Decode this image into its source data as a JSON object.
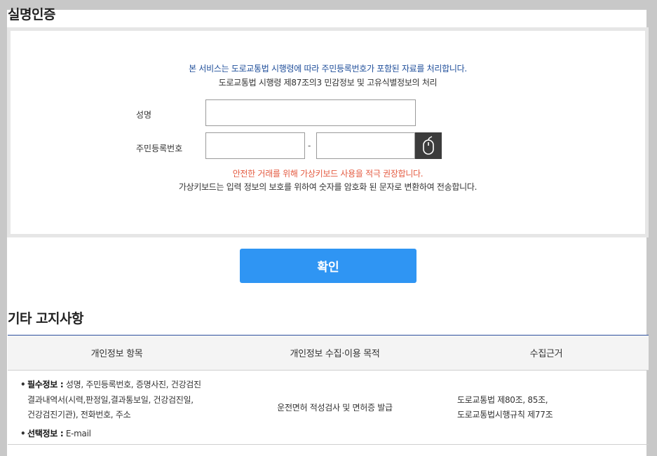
{
  "page": {
    "title": "실명인증"
  },
  "verify": {
    "notice_blue": "본 서비스는 도로교통법 시행령에 따라 주민등록번호가 포함된 자료를 처리합니다.",
    "notice_law": "도로교통법 시행령 제87조의3 민감정보 및 고유식별정보의 처리",
    "name_label": "성명",
    "name_value": "",
    "rrn_label": "주민등록번호",
    "rrn_front_value": "",
    "rrn_back_value": "",
    "rrn_separator": "-",
    "virtual_keyboard_icon": "mouse-icon",
    "notice_red": "안전한 거래를 위해 가상키보드 사용을 적극 권장합니다.",
    "notice_vk": "가상키보드는 입력 정보의 보호를 위하여 숫자를 암호화 된 문자로 변환하여 전송합니다."
  },
  "confirm_label": "확인",
  "other_notice": {
    "title": "기타 고지사항",
    "headers": [
      "개인정보 항목",
      "개인정보 수집·이용 목적",
      "수집근거"
    ],
    "row": {
      "required_label": "필수정보 :",
      "required_line1": " 성명, 주민등록번호, 증명사진, 건강검진",
      "required_line2": "결과내역서(시력,판정일,결과통보일, 건강검진일,",
      "required_line3": "건강검진기관), 전화번호, 주소",
      "optional_label": "선택정보 :",
      "optional_value": " E-mail",
      "purpose": "운전면허 적성검사 및 면허증 발급",
      "basis_line1": "도로교통법 제80조, 85조,",
      "basis_line2": "도로교통법시행규칙 제77조"
    }
  },
  "colors": {
    "accent_blue": "#2f95f3",
    "notice_blue": "#1f4e9a",
    "notice_red": "#e45a40",
    "table_top_border": "#2c4f9e"
  }
}
